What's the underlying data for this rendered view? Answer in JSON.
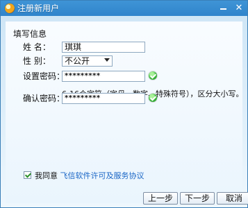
{
  "window": {
    "title": "注册新用户",
    "minimize_label": "",
    "close_label": "✕"
  },
  "form": {
    "section_title": "填写信息",
    "name": {
      "label": "姓    名：",
      "value": "琪琪"
    },
    "gender": {
      "label": "性    别：",
      "selected": "不公开"
    },
    "password": {
      "label": "设置密码：",
      "value": "*********",
      "hint": "6-16个字符（字母、数字、特殊符号），区分大小写。"
    },
    "confirm": {
      "label": "确认密码：",
      "value": "*********"
    }
  },
  "agreement": {
    "prefix": "我同意 ",
    "link": "飞信软件许可及服务协议"
  },
  "buttons": {
    "prev": "上一步",
    "next": "下一步",
    "cancel": "取消"
  },
  "colors": {
    "titlebar": "#2f84cb",
    "link": "#1a66c6",
    "ok_green": "#3cb63c"
  }
}
